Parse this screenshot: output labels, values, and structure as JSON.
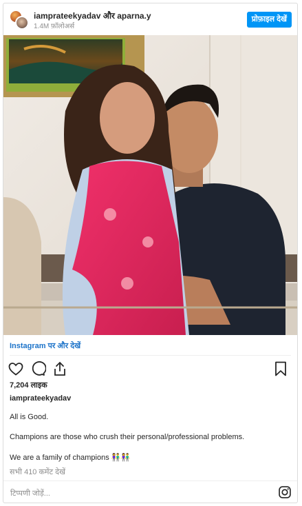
{
  "header": {
    "names": "iamprateekyadav और aparna.y",
    "followers": "1.4M फ़ॉलोअर्स",
    "profile_button": "प्रोफ़ाइल देखें"
  },
  "photo": {
    "subject": "couple-photo"
  },
  "post": {
    "view_more": "Instagram पर और देखें",
    "likes": "7,204 लाइक",
    "username": "iamprateekyadav",
    "caption": [
      "All is Good.",
      "Champions are those who crush their personal/professional problems.",
      "We are a family of champions 👫👫"
    ],
    "comments_link": "सभी 410 कमेंट देखें",
    "comment_placeholder": "टिप्पणी जोड़ें..."
  },
  "icons": [
    "heart-icon",
    "comment-icon",
    "share-icon",
    "bookmark-icon",
    "instagram-icon"
  ],
  "colors": {
    "accent": "#0095f6",
    "link": "#1c73c9",
    "saree": "#e8245e",
    "tshirt": "#1e2430"
  }
}
